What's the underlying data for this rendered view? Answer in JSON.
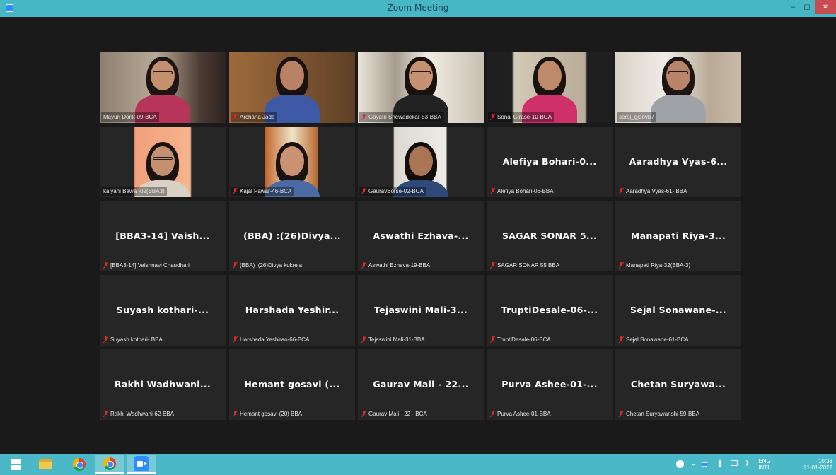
{
  "window": {
    "title": "Zoom Meeting",
    "min": "–",
    "max": "◻",
    "close": "×"
  },
  "participants": [
    {
      "id": 0,
      "display_name": "Mayuri Dorik-09-BCA",
      "muted": false,
      "video": true,
      "active": true
    },
    {
      "id": 1,
      "display_name": "Archana Jade",
      "muted": true,
      "video": true
    },
    {
      "id": 2,
      "display_name": "Gayatri Shewadekar-53-BBA",
      "muted": true,
      "video": true
    },
    {
      "id": 3,
      "display_name": "Sonal Girase-10-BCA",
      "muted": true,
      "video": true
    },
    {
      "id": 4,
      "display_name": "seroj_gjaovb7",
      "muted": false,
      "video": true
    },
    {
      "id": 5,
      "display_name": "kalyani Bawa -02(BBA3)",
      "muted": false,
      "video": true
    },
    {
      "id": 6,
      "display_name": "Kajal Pawar-46-BCA",
      "muted": true,
      "video": true
    },
    {
      "id": 7,
      "display_name": "GauravBorse-02-BCA",
      "muted": true,
      "video": true
    },
    {
      "id": 8,
      "display_name": "Alefiya Bohari-06-BBA",
      "short_name": "Alefiya Bohari-0...",
      "muted": true,
      "video": false
    },
    {
      "id": 9,
      "display_name": "Aaradhya Vyas-61- BBA",
      "short_name": "Aaradhya Vyas-6...",
      "muted": true,
      "video": false
    },
    {
      "id": 10,
      "display_name": "[BBA3-14] Vaishnavi Chaudhari",
      "short_name": "[BBA3-14] Vaish...",
      "muted": true,
      "video": false
    },
    {
      "id": 11,
      "display_name": "(BBA) :(26)Divya kukreja",
      "short_name": "(BBA) :(26)Divya...",
      "muted": true,
      "video": false
    },
    {
      "id": 12,
      "display_name": "Aswathi Ezhava-19-BBA",
      "short_name": "Aswathi Ezhava-...",
      "muted": true,
      "video": false
    },
    {
      "id": 13,
      "display_name": "SAGAR SONAR 55 BBA",
      "short_name": "SAGAR SONAR 5...",
      "muted": true,
      "video": false
    },
    {
      "id": 14,
      "display_name": "Manapati Riya-32(BBA-3)",
      "short_name": "Manapati Riya-3...",
      "muted": true,
      "video": false
    },
    {
      "id": 15,
      "display_name": "Suyash kothari- BBA",
      "short_name": "Suyash kothari-...",
      "muted": true,
      "video": false
    },
    {
      "id": 16,
      "display_name": "Harshada Yeshirao-66-BCA",
      "short_name": "Harshada Yeshir...",
      "muted": true,
      "video": false
    },
    {
      "id": 17,
      "display_name": "Tejaswini Mali-31-BBA",
      "short_name": "Tejaswini Mali-3...",
      "muted": true,
      "video": false
    },
    {
      "id": 18,
      "display_name": "TruptiDesale-06-BCA",
      "short_name": "TruptiDesale-06-...",
      "muted": true,
      "video": false
    },
    {
      "id": 19,
      "display_name": "Sejal Sonawane-61-BCA",
      "short_name": "Sejal Sonawane-...",
      "muted": true,
      "video": false
    },
    {
      "id": 20,
      "display_name": "Rakhi Wadhwani-62-BBA",
      "short_name": "Rakhi Wadhwani...",
      "muted": true,
      "video": false
    },
    {
      "id": 21,
      "display_name": "Hemant gosavi (20) BBA",
      "short_name": "Hemant gosavi (...",
      "muted": true,
      "video": false
    },
    {
      "id": 22,
      "display_name": "Gaurav Mali - 22 - BCA",
      "short_name": "Gaurav Mali - 22...",
      "muted": true,
      "video": false
    },
    {
      "id": 23,
      "display_name": "Purva Ashee-01-BBA",
      "short_name": "Purva Ashee-01-...",
      "muted": true,
      "video": false
    },
    {
      "id": 24,
      "display_name": "Chetan Suryawanshi-59-BBA",
      "short_name": "Chetan Suryawa...",
      "muted": true,
      "video": false
    }
  ],
  "taskbar": {
    "items": [
      "start-icon",
      "file-explorer-icon",
      "chrome-icon",
      "chrome-profile-icon",
      "zoom-icon"
    ],
    "lang_top": "ENG",
    "lang_bottom": "INTL",
    "time": "10:38",
    "date": "21-01-2022"
  },
  "colors": {
    "titlebar": "#47b7c6",
    "active_speaker": "#c8e255",
    "tile_bg": "#262626",
    "muted_icon": "#e02828"
  }
}
